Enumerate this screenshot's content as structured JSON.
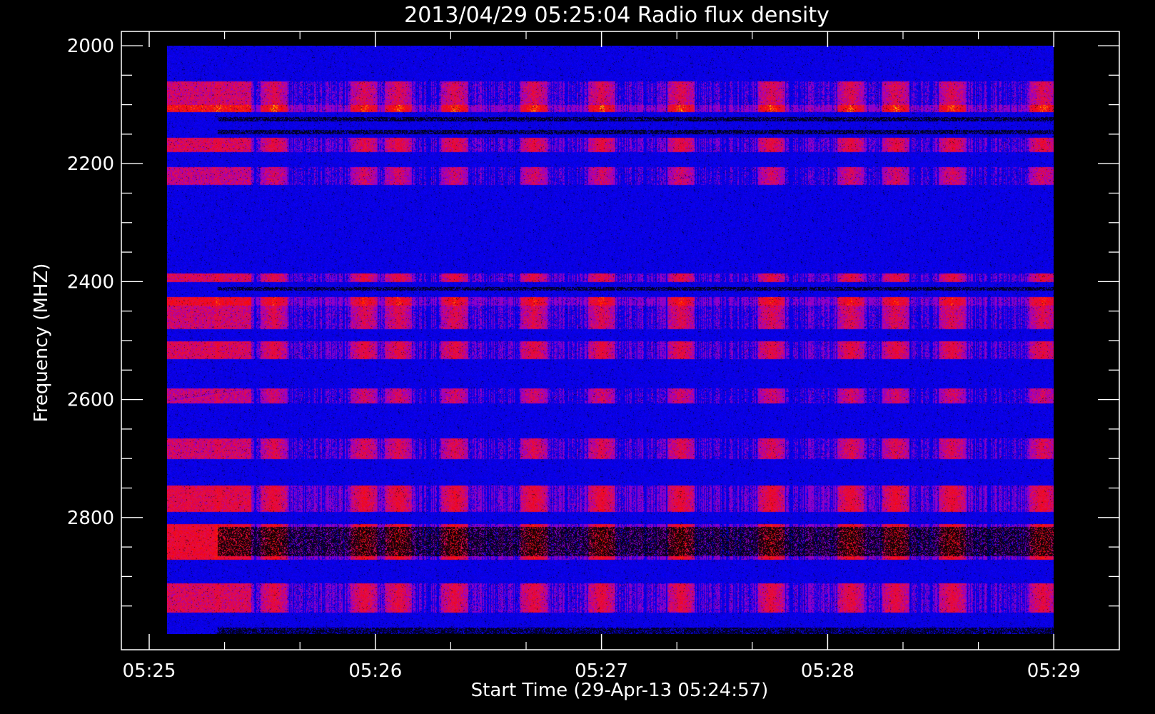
{
  "chart_data": {
    "type": "heatmap",
    "title": "2013/04/29 05:25:04 Radio flux density",
    "xlabel": "Start Time (29-Apr-13 05:24:57)",
    "ylabel": "Frequency (MHZ)",
    "x_ticks": [
      "05:25",
      "05:26",
      "05:27",
      "05:28",
      "05:29"
    ],
    "x_tick_minutes": [
      0,
      1,
      2,
      3,
      4
    ],
    "x_minor_per_major": 3,
    "x_data_range_minutes": [
      0,
      4.0
    ],
    "y_ticks": [
      2000,
      2200,
      2400,
      2600,
      2800
    ],
    "y_minor_step": 50,
    "y_range": [
      2000,
      3000
    ],
    "data_y_range": [
      2000,
      2997
    ],
    "grid": false,
    "colormap": [
      "#000000",
      "#0000ff",
      "#ff0000",
      "#ffff66"
    ],
    "background_level": "blue",
    "bright_bands_mhz": [
      {
        "from": 2060,
        "to": 2110,
        "intensity": 0.55
      },
      {
        "from": 2100,
        "to": 2112,
        "intensity": 0.9
      },
      {
        "from": 2155,
        "to": 2180,
        "intensity": 0.6
      },
      {
        "from": 2205,
        "to": 2235,
        "intensity": 0.5
      },
      {
        "from": 2385,
        "to": 2400,
        "intensity": 0.6
      },
      {
        "from": 2425,
        "to": 2440,
        "intensity": 0.8
      },
      {
        "from": 2440,
        "to": 2480,
        "intensity": 0.55
      },
      {
        "from": 2500,
        "to": 2530,
        "intensity": 0.6
      },
      {
        "from": 2580,
        "to": 2605,
        "intensity": 0.5
      },
      {
        "from": 2665,
        "to": 2700,
        "intensity": 0.55
      },
      {
        "from": 2745,
        "to": 2790,
        "intensity": 0.65
      },
      {
        "from": 2810,
        "to": 2870,
        "intensity": 0.75
      },
      {
        "from": 2910,
        "to": 2960,
        "intensity": 0.6
      }
    ],
    "dark_bands_mhz": [
      {
        "from": 2120,
        "to": 2128
      },
      {
        "from": 2142,
        "to": 2150
      },
      {
        "from": 2408,
        "to": 2415
      },
      {
        "from": 2815,
        "to": 2865
      },
      {
        "from": 2985,
        "to": 2997
      }
    ],
    "bright_time_stripes_minutes": [
      0.05,
      0.3,
      0.55,
      0.95,
      1.1,
      1.35,
      1.7,
      2.0,
      2.35,
      2.75,
      3.1,
      3.3,
      3.55,
      3.95
    ]
  }
}
